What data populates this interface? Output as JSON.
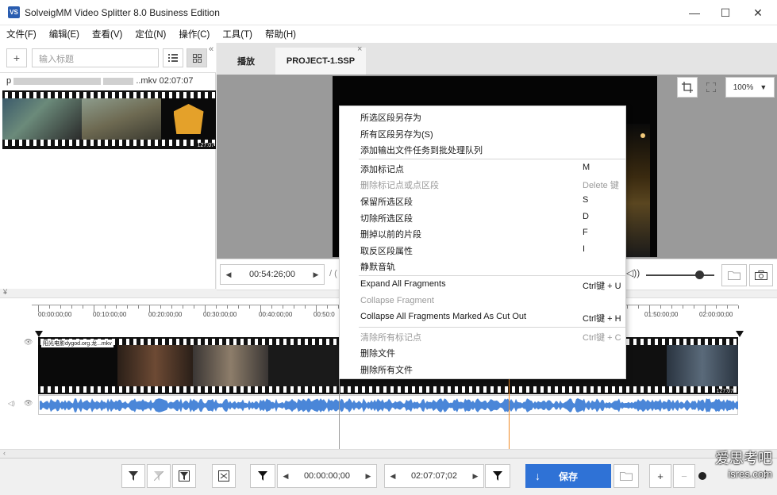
{
  "window": {
    "title": "SolveigMM Video Splitter 8.0 Business Edition",
    "app_icon": "VS",
    "min": "—",
    "max": "☐",
    "close": "✕"
  },
  "menubar": [
    "文件(F)",
    "编辑(E)",
    "查看(V)",
    "定位(N)",
    "操作(C)",
    "工具(T)",
    "帮助(H)"
  ],
  "left_panel": {
    "add": "+",
    "search_placeholder": "输入标题",
    "file_suffix": "..mkv 02:07:07",
    "file_prefix": "p",
    "thumb_time": "127:07",
    "collapse": "«"
  },
  "tabs": {
    "media": "播放",
    "project": "PROJECT-1.SSP",
    "close": "×"
  },
  "preview": {
    "zoom": "100%"
  },
  "controls": {
    "current_time": "00:54:26;00",
    "slash": "/ ("
  },
  "ruler": [
    "00:00:00;00",
    "00:10:00;00",
    "00:20:00;00",
    "00:30:00;00",
    "00:40:00;00",
    "00:50:0",
    "01:50:00;00",
    "02:00:00;00"
  ],
  "track": {
    "label": "阳光电影dygod.org.龙...mkv",
    "end_time": "127:07"
  },
  "context_menu": [
    {
      "label": "所选区段另存为",
      "key": "",
      "disabled": false
    },
    {
      "label": "所有区段另存为(S)",
      "key": "",
      "disabled": false
    },
    {
      "label": "添加输出文件任务到批处理队列",
      "key": "",
      "disabled": false
    },
    {
      "label": "添加标记点",
      "key": "M",
      "disabled": false
    },
    {
      "label": "删除标记点或点区段",
      "key": "Delete 键",
      "disabled": true
    },
    {
      "label": "保留所选区段",
      "key": "S",
      "disabled": false
    },
    {
      "label": "切除所选区段",
      "key": "D",
      "disabled": false
    },
    {
      "label": "删掉以前的片段",
      "key": "F",
      "disabled": false
    },
    {
      "label": "取反区段属性",
      "key": "I",
      "disabled": false
    },
    {
      "label": "静默音轨",
      "key": "",
      "disabled": false
    },
    {
      "label": "Expand All Fragments",
      "key": "Ctrl键 + U",
      "disabled": false
    },
    {
      "label": "Collapse Fragment",
      "key": "",
      "disabled": true
    },
    {
      "label": "Collapse All Fragments Marked As Cut Out",
      "key": "Ctrl键 + H",
      "disabled": false
    },
    {
      "label": "清除所有标记点",
      "key": "Ctrl键 + C",
      "disabled": true
    },
    {
      "label": "删除文件",
      "key": "",
      "disabled": false
    },
    {
      "label": "删除所有文件",
      "key": "",
      "disabled": false
    }
  ],
  "bottom": {
    "start_time": "00:00:00;00",
    "end_time": "02:07:07;02",
    "save": "保存",
    "plus": "+",
    "minus": "−"
  },
  "watermark": {
    "line1": "爱思考吧",
    "line2": "isres.com"
  },
  "colors": {
    "accent": "#2f72d6",
    "playhead": "#f08a24",
    "wave": "#4a86d8"
  }
}
